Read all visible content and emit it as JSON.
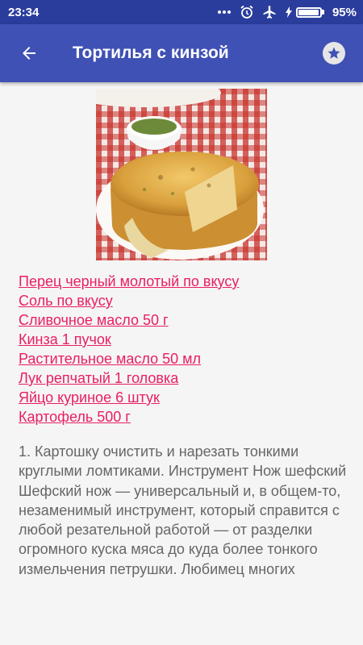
{
  "status_bar": {
    "time": "23:34",
    "battery_percent": "95%",
    "battery_level": 0.95,
    "icons": [
      "more-dots-icon",
      "alarm-icon",
      "airplane-mode-icon",
      "charging-icon",
      "battery-icon"
    ]
  },
  "app_bar": {
    "title": "Тортилья с кинзой",
    "back_icon": "arrow-left-icon",
    "favorite_icon": "star-icon",
    "color": "#3f51b5",
    "status_color": "#2b3d9c"
  },
  "ingredients": [
    "Перец черный молотый по вкусу",
    "Соль по вкусу",
    "Сливочное масло 50 г",
    "Кинза 1 пучок",
    "Растительное масло 50 мл",
    "Лук репчатый 1 головка",
    "Яйцо куриное 6 штук",
    "Картофель 500 г"
  ],
  "link_color": "#e91e63",
  "step_text": "1. Картошку очистить и нарезать тонкими круглыми ломтиками. Инструмент Нож шефский Шефский нож — универсальный и, в общем-то, незаменимый инструмент, который справится с любой резательной работой — от разделки огромного куска мяса до куда более тонкого измельчения петрушки. Любимец многих"
}
